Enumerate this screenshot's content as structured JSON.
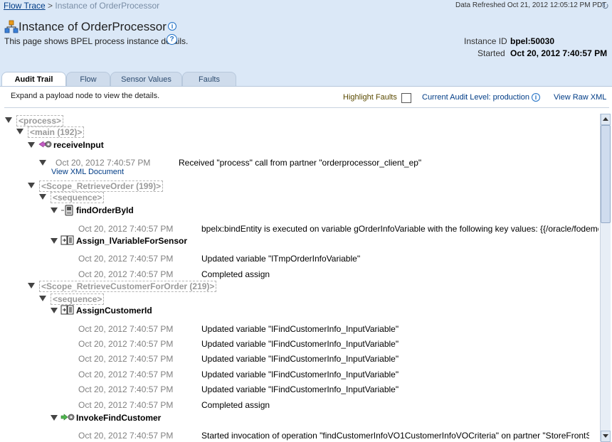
{
  "breadcrumb": {
    "parent": "Flow Trace",
    "separator": ">",
    "current": "Instance of OrderProcessor"
  },
  "refresh": {
    "text": "Data Refreshed Oct 21, 2012 12:05:12 PM PDT"
  },
  "page": {
    "title": "Instance of OrderProcessor",
    "subtitle": "This page shows BPEL process instance details."
  },
  "instance": {
    "id_label": "Instance ID",
    "id_value": "bpel:50030",
    "started_label": "Started",
    "started_value": "Oct 20, 2012 7:40:57 PM"
  },
  "tabs": [
    {
      "label": "Audit Trail",
      "active": true
    },
    {
      "label": "Flow",
      "active": false
    },
    {
      "label": "Sensor Values",
      "active": false
    },
    {
      "label": "Faults",
      "active": false
    }
  ],
  "toolbar": {
    "hint": "Expand a payload node to view the details.",
    "highlight_faults": "Highlight Faults",
    "audit_level": "Current Audit Level: production",
    "view_raw_xml": "View Raw XML"
  },
  "tree": {
    "process": "<process>",
    "main": "<main (192)>",
    "receive_input": {
      "name": "receiveInput",
      "ts": "Oct 20, 2012 7:40:57 PM",
      "msg": "Received \"process\" call from partner \"orderprocessor_client_ep\"",
      "link": "View XML Document"
    },
    "scope_retrieve_order": "<Scope_RetrieveOrder (199)>",
    "seq1": "<sequence>",
    "find_order": {
      "name": "findOrderById",
      "ts": "Oct 20, 2012 7:40:57 PM",
      "msg": "bpelx:bindEntity is executed on variable gOrderInfoVariable with the following key values: {{/oracle/fodemo/storefro"
    },
    "assign_sensor": {
      "name": "Assign_lVariableForSensor",
      "rows": [
        {
          "ts": "Oct 20, 2012 7:40:57 PM",
          "msg": "Updated variable \"lTmpOrderInfoVariable\""
        },
        {
          "ts": "Oct 20, 2012 7:40:57 PM",
          "msg": "Completed assign"
        }
      ]
    },
    "scope_retrieve_customer": "<Scope_RetrieveCustomerForOrder (219)>",
    "seq2": "<sequence>",
    "assign_customer": {
      "name": "AssignCustomerId",
      "rows": [
        {
          "ts": "Oct 20, 2012 7:40:57 PM",
          "msg": "Updated variable \"lFindCustomerInfo_InputVariable\""
        },
        {
          "ts": "Oct 20, 2012 7:40:57 PM",
          "msg": "Updated variable \"lFindCustomerInfo_InputVariable\""
        },
        {
          "ts": "Oct 20, 2012 7:40:57 PM",
          "msg": "Updated variable \"lFindCustomerInfo_InputVariable\""
        },
        {
          "ts": "Oct 20, 2012 7:40:57 PM",
          "msg": "Updated variable \"lFindCustomerInfo_InputVariable\""
        },
        {
          "ts": "Oct 20, 2012 7:40:57 PM",
          "msg": "Updated variable \"lFindCustomerInfo_InputVariable\""
        },
        {
          "ts": "Oct 20, 2012 7:40:57 PM",
          "msg": "Completed assign"
        }
      ]
    },
    "invoke_customer": {
      "name": "InvokeFindCustomer",
      "ts": "Oct 20, 2012 7:40:57 PM",
      "msg": "Started invocation of operation \"findCustomerInfoVO1CustomerInfoVOCriteria\" on partner \"StoreFrontService\"."
    }
  },
  "colors": {
    "header_bg": "#dbe8f7",
    "link": "#003c86",
    "timestamp": "#808080"
  }
}
